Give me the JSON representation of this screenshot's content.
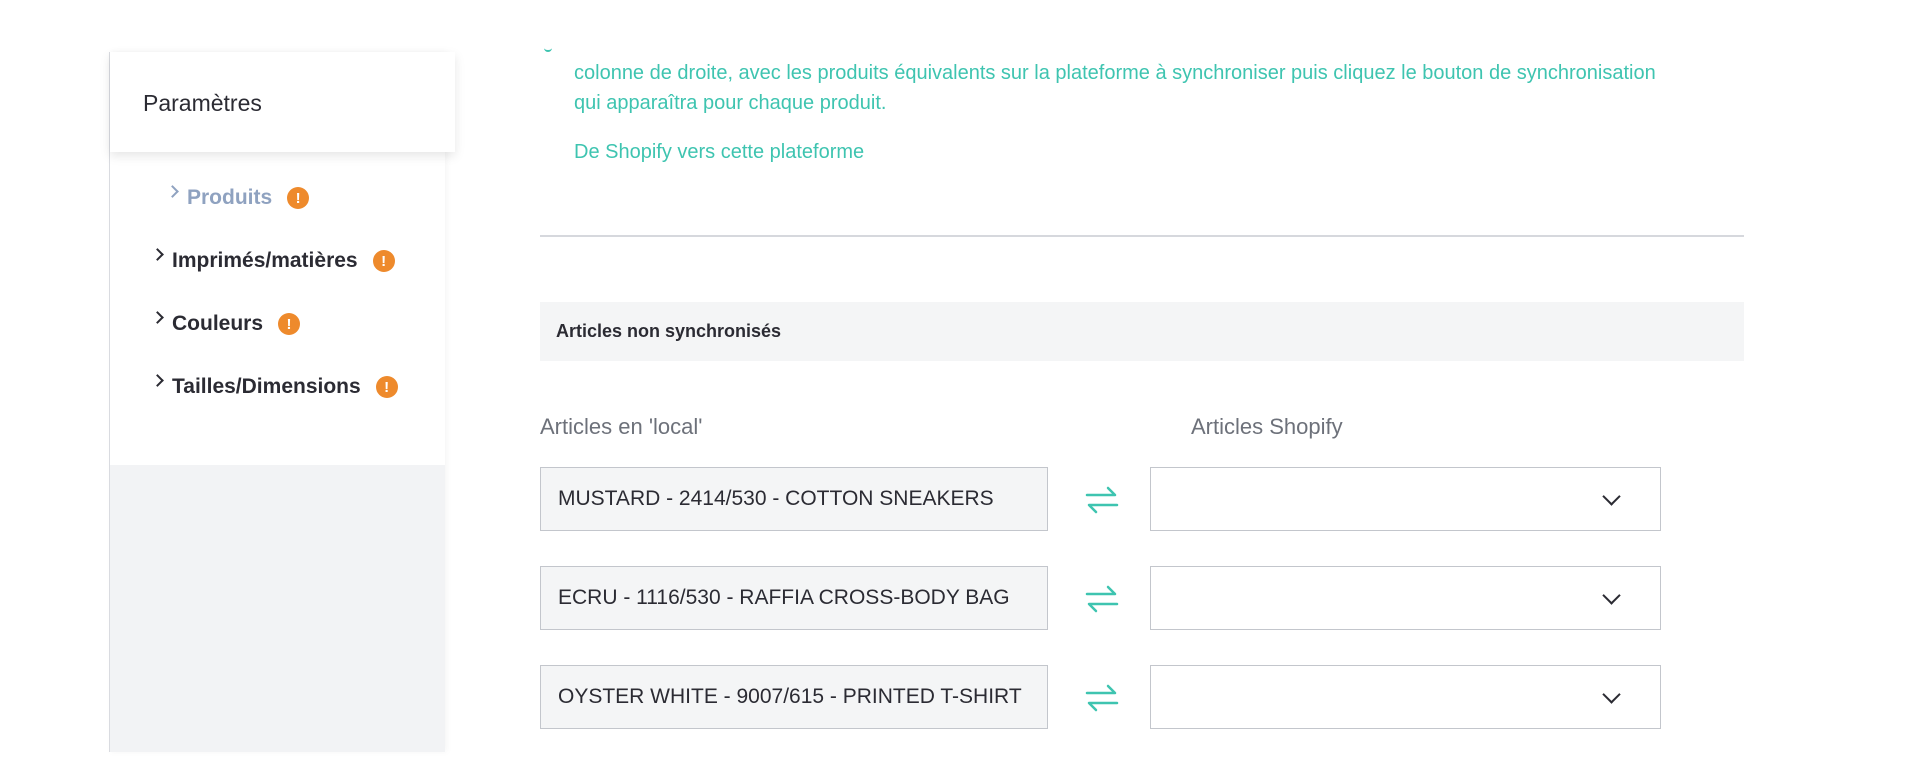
{
  "sidebar": {
    "header_title": "Paramètres",
    "items": [
      {
        "label": "Produits",
        "active": true,
        "warning": "!"
      },
      {
        "label": "Imprimés/matières",
        "active": false,
        "warning": "!"
      },
      {
        "label": "Couleurs",
        "active": false,
        "warning": "!"
      },
      {
        "label": "Tailles/Dimensions",
        "active": false,
        "warning": "!"
      }
    ]
  },
  "main": {
    "intro_text": "colonne de droite, avec les produits équivalents sur la plateforme à synchroniser puis cliquez le bouton de synchronisation qui apparaîtra pour chaque produit.",
    "shopify_link": "De Shopify vers cette plateforme",
    "section_title": "Articles non synchronisés",
    "col_local": "Articles en 'local'",
    "col_shopify": "Articles Shopify",
    "rows": [
      {
        "local": "MUSTARD - 2414/530 - COTTON SNEAKERS",
        "shopify_value": ""
      },
      {
        "local": "ECRU - 1116/530 - RAFFIA CROSS-BODY BAG",
        "shopify_value": ""
      },
      {
        "local": "OYSTER WHITE - 9007/615 - PRINTED T-SHIRT",
        "shopify_value": ""
      }
    ]
  },
  "colors": {
    "accent_teal": "#3ec4b0",
    "warning_orange": "#ee8a2c",
    "active_menu": "#8fa2c0"
  },
  "icons": {
    "sync": "sync-arrows-icon",
    "chevron": "chevron-right-icon",
    "dropdown": "chevron-down-icon",
    "warning": "warning-icon"
  }
}
